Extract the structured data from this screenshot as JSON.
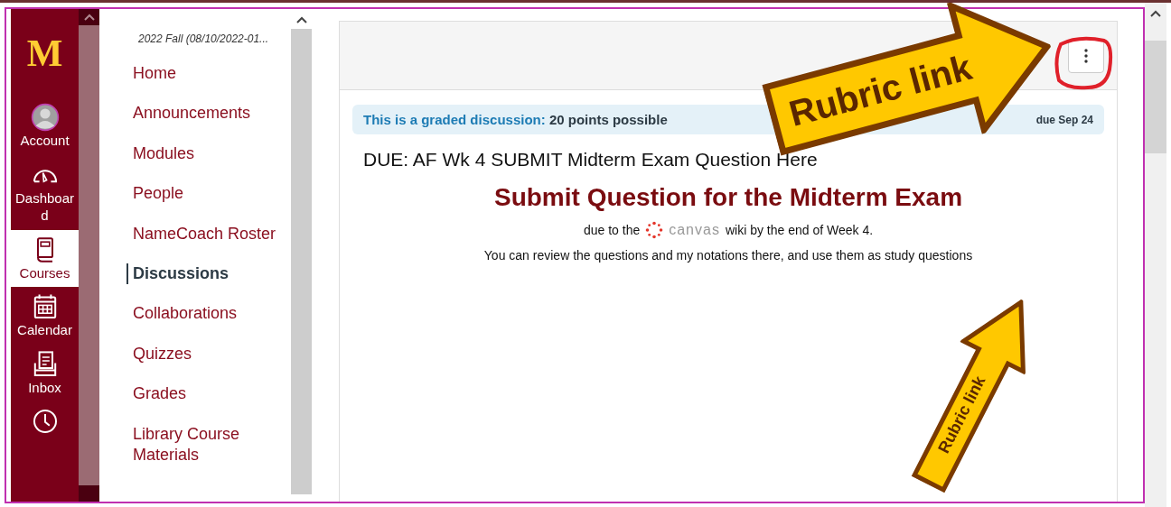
{
  "global_nav": {
    "logo": "M",
    "items": [
      {
        "kind": "account",
        "label": "Account",
        "selected": false
      },
      {
        "kind": "dashboard",
        "label": "Dashboard",
        "selected": false
      },
      {
        "kind": "courses",
        "label": "Courses",
        "selected": true
      },
      {
        "kind": "calendar",
        "label": "Calendar",
        "selected": false
      },
      {
        "kind": "inbox",
        "label": "Inbox",
        "selected": false
      },
      {
        "kind": "history",
        "selected": false
      }
    ]
  },
  "course_nav": {
    "term": "2022 Fall (08/10/2022-01...",
    "items": [
      {
        "label": "Home",
        "selected": false
      },
      {
        "label": "Announcements",
        "selected": false
      },
      {
        "label": "Modules",
        "selected": false
      },
      {
        "label": "People",
        "selected": false
      },
      {
        "label": "NameCoach Roster",
        "selected": false
      },
      {
        "label": "Discussions",
        "selected": true
      },
      {
        "label": "Collaborations",
        "selected": false
      },
      {
        "label": "Quizzes",
        "selected": false
      },
      {
        "label": "Grades",
        "selected": false
      },
      {
        "label": "Library Course Materials",
        "selected": false
      }
    ]
  },
  "discussion": {
    "graded_label": "This is a graded discussion:",
    "points": "20 points possible",
    "due": "due Sep 24",
    "title": "DUE: AF Wk 4 SUBMIT Midterm Exam Question Here",
    "heading": "Submit Question for the Midterm Exam",
    "due_before": "due to the",
    "logo_text": "canvas",
    "due_after": "wiki by the end of Week 4.",
    "body": "You can review the questions and my notations there, and use them as study questions"
  },
  "annotations": [
    {
      "text": "Rubric link"
    },
    {
      "text": "Rubric link"
    }
  ]
}
